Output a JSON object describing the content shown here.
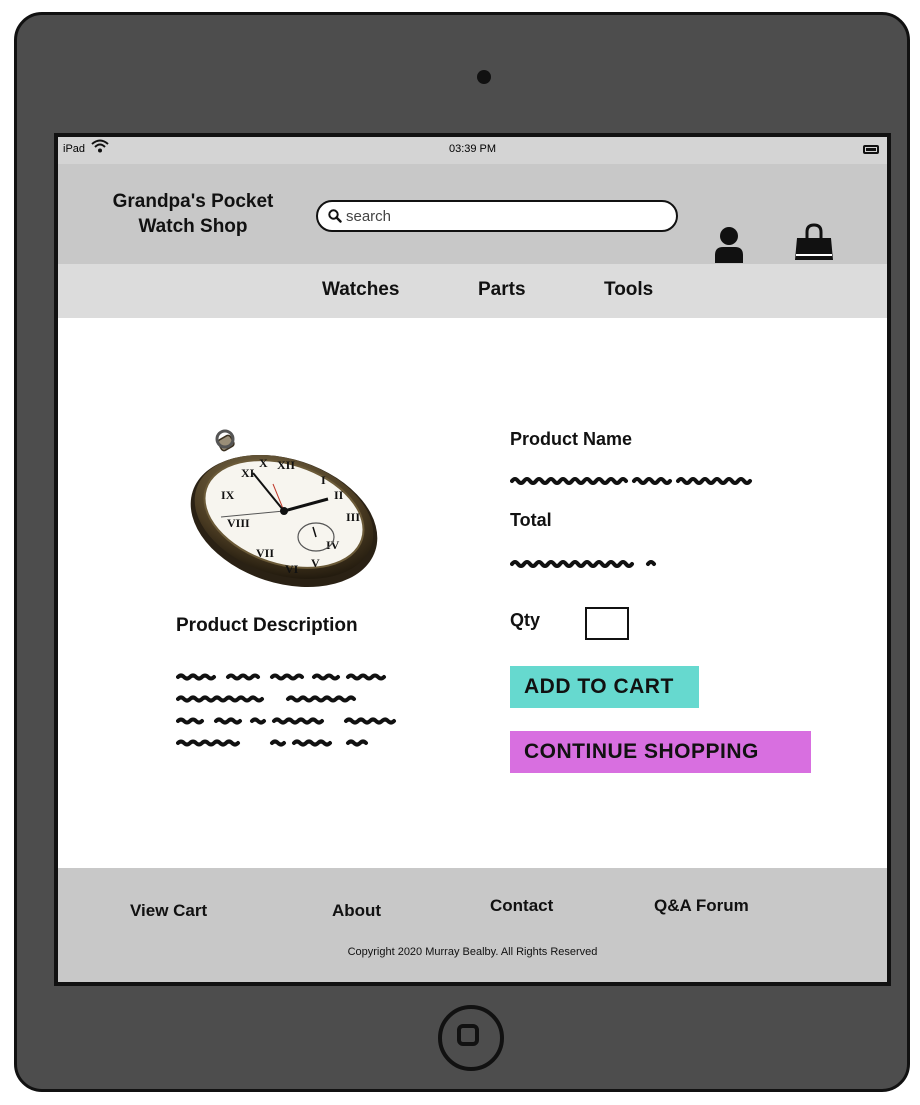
{
  "statusbar": {
    "device": "iPad",
    "time": "03:39 PM"
  },
  "header": {
    "logo_line1": "Grandpa's Pocket",
    "logo_line2": "Watch Shop",
    "search_placeholder": "search"
  },
  "nav": {
    "items": [
      {
        "label": "Watches"
      },
      {
        "label": "Parts"
      },
      {
        "label": "Tools"
      }
    ]
  },
  "product": {
    "description_label": "Product Description",
    "name_label": "Product Name",
    "total_label": "Total",
    "qty_label": "Qty",
    "add_to_cart": "ADD TO CART",
    "continue_shopping": "CONTINUE SHOPPING"
  },
  "footer": {
    "links": [
      {
        "label": "View Cart"
      },
      {
        "label": "About"
      },
      {
        "label": "Contact"
      },
      {
        "label": "Q&A Forum"
      }
    ],
    "copyright": "Copyright  2020 Murray Bealby. All Rights Reserved"
  },
  "colors": {
    "header_bg": "#c8c8c8",
    "nav_bg": "#dcdcdc",
    "add_to_cart_bg": "#66d9cf",
    "continue_bg": "#d86fe0",
    "device_frame": "#4d4d4d"
  },
  "icons": [
    "wifi-icon",
    "battery-icon",
    "search-icon",
    "user-icon",
    "shopping-bag-icon",
    "home-button-icon"
  ]
}
